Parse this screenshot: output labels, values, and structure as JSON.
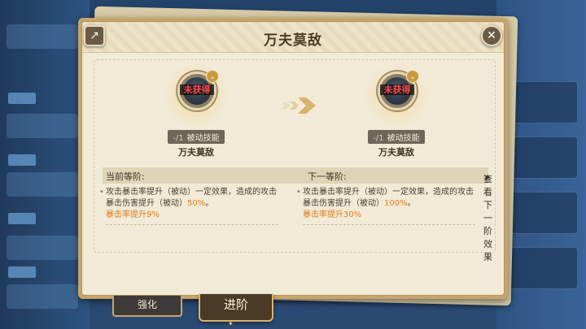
{
  "window": {
    "title": "万夫莫敌"
  },
  "icons": {
    "share": "share-out-icon",
    "close": "close-icon",
    "chevron": "double-chevron-down-icon",
    "arrow": "advance-arrow-icon"
  },
  "current": {
    "locked_label": "未获得",
    "level": "-/1",
    "type": "被动技能",
    "name": "万夫莫敌"
  },
  "next": {
    "locked_label": "未获得",
    "level": "-/1",
    "type": "被动技能",
    "name": "万夫莫敌"
  },
  "levels": {
    "current_header": "当前等阶:",
    "next_header": "下一等阶:",
    "view_next_link": "查看下一阶效果"
  },
  "effects": {
    "current": {
      "text_a": "攻击暴击率提升（被动）一定效果，造成的攻击暴击伤害提升（被动）",
      "value": "50%",
      "text_b": "。",
      "bonus": "暴击率提升9%"
    },
    "next": {
      "text_a": "攻击暴击率提升（被动）一定效果，造成的攻击暴击伤害提升（被动）",
      "value": "100%",
      "text_b": "。",
      "bonus": "暴击率提升30%"
    }
  },
  "tabs": {
    "upgrade": "强化",
    "advance": "进阶"
  },
  "colors": {
    "panel_bg": "#f1ead7",
    "frame": "#c7a46b",
    "highlight": "#e0801c",
    "locked_text": "#ff4b4b"
  }
}
